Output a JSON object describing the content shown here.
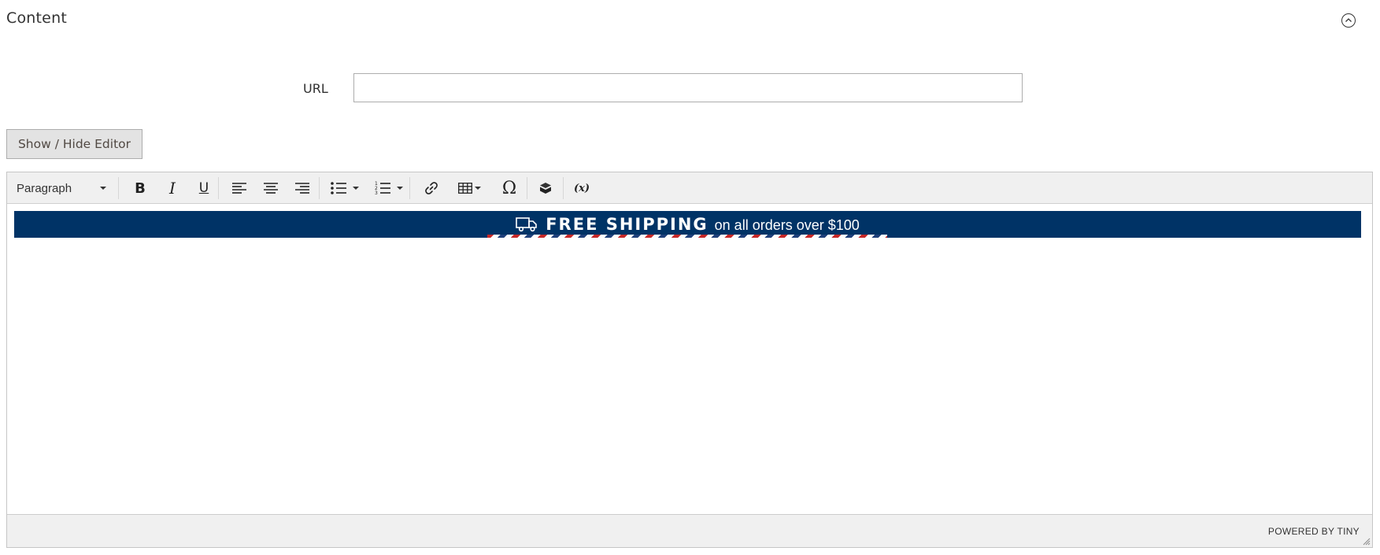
{
  "section": {
    "title": "Content"
  },
  "form": {
    "url_label": "URL",
    "url_value": "",
    "url_placeholder": ""
  },
  "editor": {
    "toggle_label": "Show / Hide Editor",
    "toolbar": {
      "format_value": "Paragraph",
      "icons": [
        "bold-icon",
        "italic-icon",
        "underline-icon",
        "align-left-icon",
        "align-center-icon",
        "align-right-icon",
        "bullet-list-icon",
        "numbered-list-icon",
        "link-icon",
        "table-icon",
        "special-character-icon",
        "widget-icon",
        "variable-icon"
      ],
      "special_char": "Ω",
      "variable_text": "(x)"
    },
    "banner": {
      "strong": "FREE SHIPPING",
      "rest": "on all orders over $100",
      "background": "#003366"
    },
    "statusbar": {
      "powered_by": "POWERED BY TINY"
    }
  }
}
